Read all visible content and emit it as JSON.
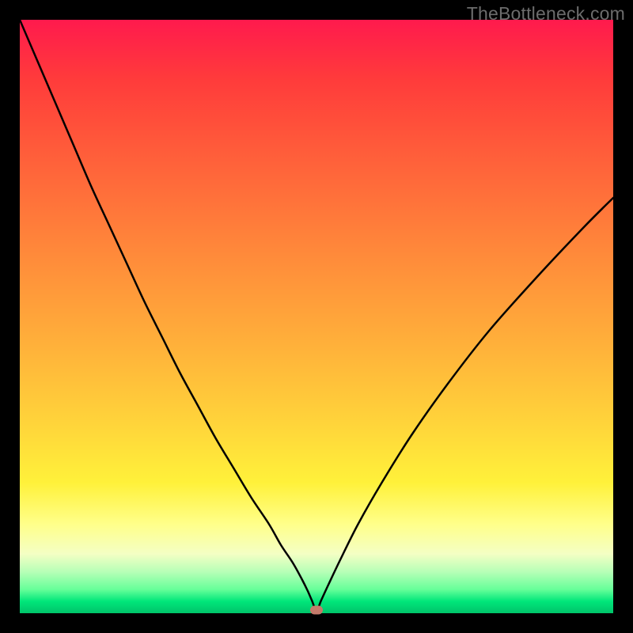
{
  "watermark": "TheBottleneck.com",
  "colors": {
    "frame": "#000000",
    "watermark_text": "#6c6c6c",
    "curve": "#000000",
    "marker": "#c47a6a",
    "gradient_stops": [
      "#ff1a4d",
      "#ff3b3b",
      "#ff5c3a",
      "#ff8b3a",
      "#ffb13a",
      "#ffd43a",
      "#fff13a",
      "#ffff8a",
      "#f4ffc4",
      "#b7ffb7",
      "#66ff99",
      "#00e67a",
      "#00c46a"
    ]
  },
  "chart_data": {
    "type": "line",
    "title": "",
    "xlabel": "",
    "ylabel": "",
    "xlim": [
      0,
      100
    ],
    "ylim": [
      0,
      100
    ],
    "grid": false,
    "x": [
      0,
      3,
      6,
      9,
      12,
      15,
      18,
      21,
      24,
      27,
      30,
      33,
      36,
      39,
      42,
      44,
      46,
      47.5,
      48.5,
      49.2,
      50,
      50.8,
      52,
      54,
      57,
      61,
      66,
      72,
      79,
      87,
      95,
      100
    ],
    "values": [
      100,
      93,
      86,
      79,
      72,
      65.5,
      59,
      52.5,
      46.5,
      40.5,
      35,
      29.5,
      24.5,
      19.5,
      15,
      11.5,
      8.5,
      5.8,
      3.8,
      2.2,
      0.5,
      2.2,
      4.8,
      9,
      15,
      22,
      30,
      38.5,
      47.5,
      56.5,
      65,
      70
    ],
    "marker": {
      "x": 50,
      "y": 0.5
    },
    "notes": "x and y are in percent of plot area; origin bottom-left; curve is bottleneck V-shape with minimum near x≈50%"
  }
}
